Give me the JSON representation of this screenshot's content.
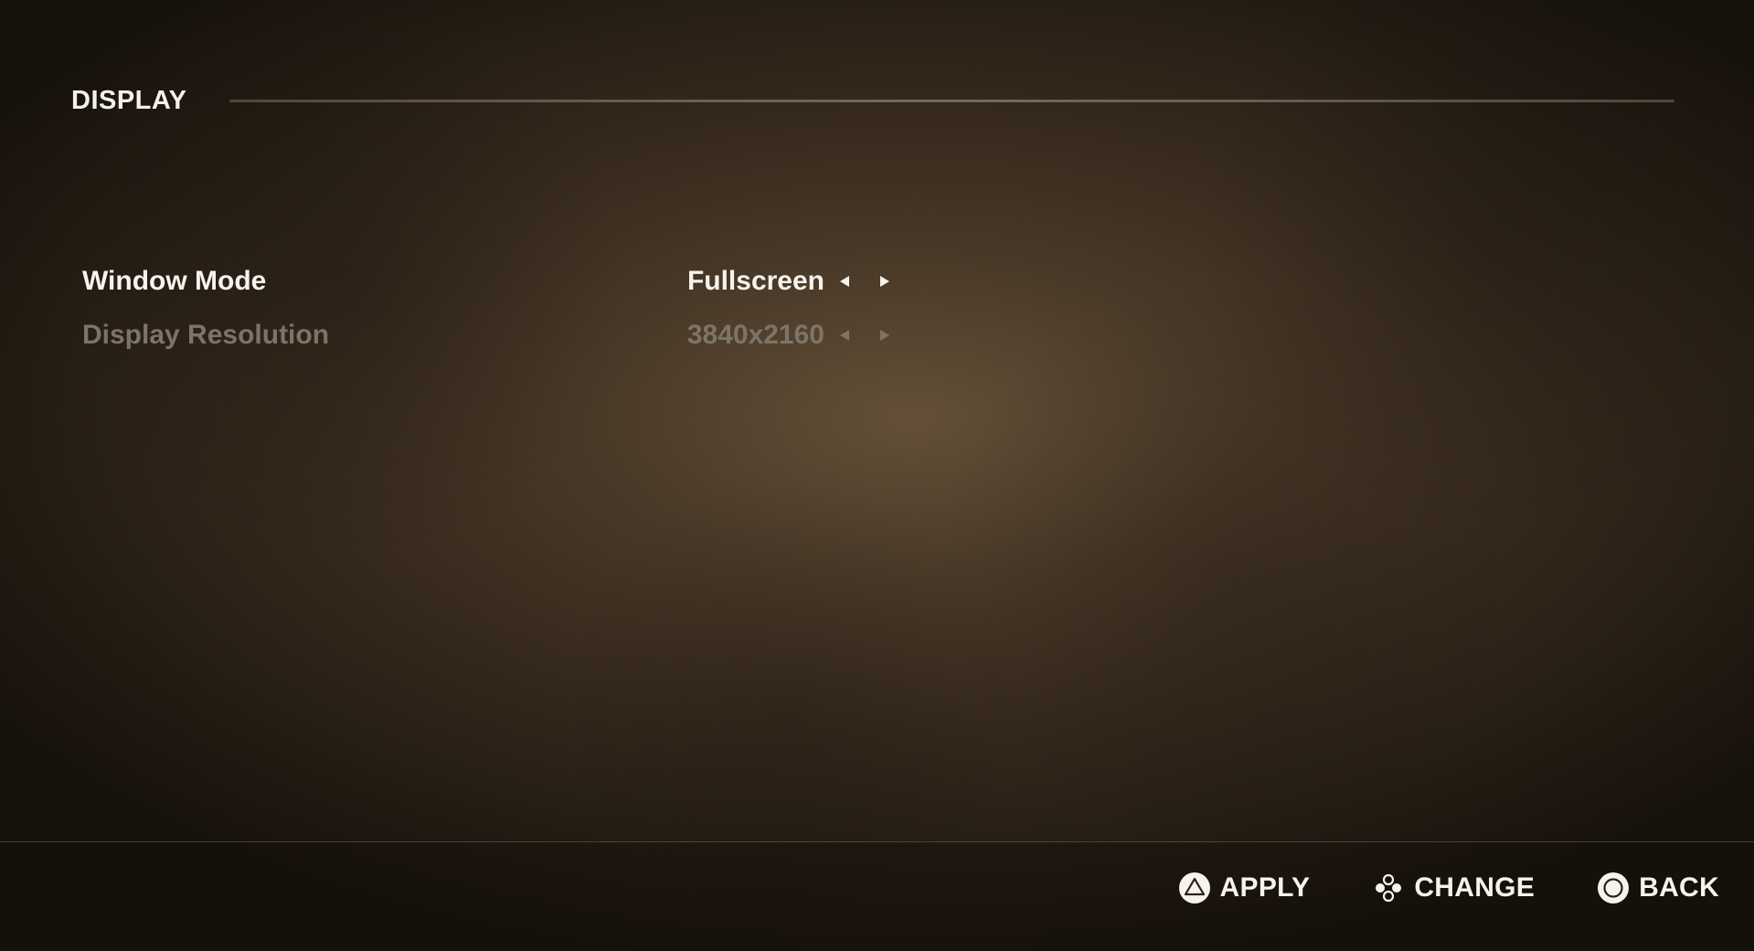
{
  "header": {
    "title": "DISPLAY"
  },
  "settings": [
    {
      "label": "Window Mode",
      "value": "Fullscreen",
      "state": "active"
    },
    {
      "label": "Display Resolution",
      "value": "3840x2160",
      "state": "disabled"
    }
  ],
  "footer": {
    "apply": {
      "label": "APPLY",
      "icon": "triangle-button-icon"
    },
    "change": {
      "label": "CHANGE",
      "icon": "dpad-icon"
    },
    "back": {
      "label": "BACK",
      "icon": "circle-button-icon"
    }
  },
  "colors": {
    "text_active": "#f6f3ee",
    "text_disabled": "#7d7468",
    "background_center": "#6e583e",
    "background_edge": "#16110b"
  }
}
